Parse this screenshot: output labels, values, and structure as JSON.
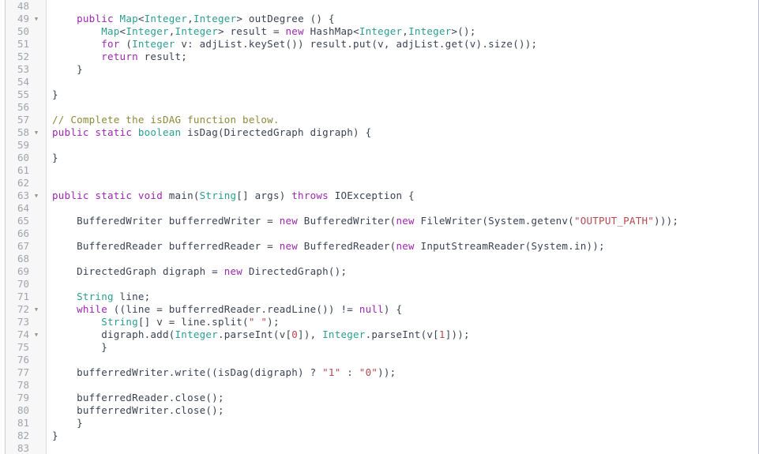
{
  "editor": {
    "language": "java",
    "first_line": 48,
    "last_line": 83,
    "line_height_px": 16,
    "colors": {
      "background": "#ffffff",
      "gutter_background": "#f7f7f7",
      "gutter_rule": "#dcdcdc",
      "left_rule": "#cfcfcf",
      "right_border": "#b9bcd0",
      "line_number": "#a0a4ab",
      "fold_arrow": "#9b8e82",
      "keyword": "#9c27b0",
      "type": "#2a9d8f",
      "string": "#b5484d",
      "comment": "#8a8a3a",
      "plain": "#3b4252"
    },
    "fold_arrow_glyph": "▼",
    "fold_lines": [
      49,
      58,
      63,
      72,
      74
    ],
    "lines": [
      {
        "n": 48,
        "fold": false,
        "tokens": []
      },
      {
        "n": 49,
        "fold": true,
        "tokens": [
          {
            "t": "    ",
            "c": "pln"
          },
          {
            "t": "public",
            "c": "kw"
          },
          {
            "t": " ",
            "c": "pln"
          },
          {
            "t": "Map",
            "c": "type"
          },
          {
            "t": "<",
            "c": "pln"
          },
          {
            "t": "Integer",
            "c": "type"
          },
          {
            "t": ",",
            "c": "pln"
          },
          {
            "t": "Integer",
            "c": "type"
          },
          {
            "t": "> outDegree () {",
            "c": "pln"
          }
        ]
      },
      {
        "n": 50,
        "fold": false,
        "tokens": [
          {
            "t": "        ",
            "c": "pln"
          },
          {
            "t": "Map",
            "c": "type"
          },
          {
            "t": "<",
            "c": "pln"
          },
          {
            "t": "Integer",
            "c": "type"
          },
          {
            "t": ",",
            "c": "pln"
          },
          {
            "t": "Integer",
            "c": "type"
          },
          {
            "t": "> result = ",
            "c": "pln"
          },
          {
            "t": "new",
            "c": "kw"
          },
          {
            "t": " HashMap<",
            "c": "pln"
          },
          {
            "t": "Integer",
            "c": "type"
          },
          {
            "t": ",",
            "c": "pln"
          },
          {
            "t": "Integer",
            "c": "type"
          },
          {
            "t": ">();",
            "c": "pln"
          }
        ]
      },
      {
        "n": 51,
        "fold": false,
        "tokens": [
          {
            "t": "        ",
            "c": "pln"
          },
          {
            "t": "for",
            "c": "kw"
          },
          {
            "t": " (",
            "c": "pln"
          },
          {
            "t": "Integer",
            "c": "type"
          },
          {
            "t": " v: adjList.keySet()) result.put(v, adjList.get(v).size());",
            "c": "pln"
          }
        ]
      },
      {
        "n": 52,
        "fold": false,
        "tokens": [
          {
            "t": "        ",
            "c": "pln"
          },
          {
            "t": "return",
            "c": "kw"
          },
          {
            "t": " result;",
            "c": "pln"
          }
        ]
      },
      {
        "n": 53,
        "fold": false,
        "tokens": [
          {
            "t": "    }",
            "c": "pln"
          }
        ]
      },
      {
        "n": 54,
        "fold": false,
        "tokens": []
      },
      {
        "n": 55,
        "fold": false,
        "tokens": [
          {
            "t": "}",
            "c": "pln"
          }
        ]
      },
      {
        "n": 56,
        "fold": false,
        "tokens": []
      },
      {
        "n": 57,
        "fold": false,
        "tokens": [
          {
            "t": "// Complete the isDAG function below.",
            "c": "cmt"
          }
        ]
      },
      {
        "n": 58,
        "fold": true,
        "tokens": [
          {
            "t": "public",
            "c": "kw"
          },
          {
            "t": " ",
            "c": "pln"
          },
          {
            "t": "static",
            "c": "kw"
          },
          {
            "t": " ",
            "c": "pln"
          },
          {
            "t": "boolean",
            "c": "type"
          },
          {
            "t": " isDag(DirectedGraph digraph) {",
            "c": "pln"
          }
        ]
      },
      {
        "n": 59,
        "fold": false,
        "tokens": []
      },
      {
        "n": 60,
        "fold": false,
        "tokens": [
          {
            "t": "}",
            "c": "pln"
          }
        ]
      },
      {
        "n": 61,
        "fold": false,
        "tokens": []
      },
      {
        "n": 62,
        "fold": false,
        "tokens": []
      },
      {
        "n": 63,
        "fold": true,
        "tokens": [
          {
            "t": "public",
            "c": "kw"
          },
          {
            "t": " ",
            "c": "pln"
          },
          {
            "t": "static",
            "c": "kw"
          },
          {
            "t": " ",
            "c": "pln"
          },
          {
            "t": "void",
            "c": "kw"
          },
          {
            "t": " main(",
            "c": "pln"
          },
          {
            "t": "String",
            "c": "type"
          },
          {
            "t": "[] args) ",
            "c": "pln"
          },
          {
            "t": "throws",
            "c": "kw"
          },
          {
            "t": " IOException {",
            "c": "pln"
          }
        ]
      },
      {
        "n": 64,
        "fold": false,
        "tokens": []
      },
      {
        "n": 65,
        "fold": false,
        "tokens": [
          {
            "t": "    BufferedWriter bufferredWriter = ",
            "c": "pln"
          },
          {
            "t": "new",
            "c": "kw"
          },
          {
            "t": " BufferedWriter(",
            "c": "pln"
          },
          {
            "t": "new",
            "c": "kw"
          },
          {
            "t": " FileWriter(System.getenv(",
            "c": "pln"
          },
          {
            "t": "\"OUTPUT_PATH\"",
            "c": "str"
          },
          {
            "t": ")));",
            "c": "pln"
          }
        ]
      },
      {
        "n": 66,
        "fold": false,
        "tokens": []
      },
      {
        "n": 67,
        "fold": false,
        "tokens": [
          {
            "t": "    BufferedReader bufferredReader = ",
            "c": "pln"
          },
          {
            "t": "new",
            "c": "kw"
          },
          {
            "t": " BufferedReader(",
            "c": "pln"
          },
          {
            "t": "new",
            "c": "kw"
          },
          {
            "t": " InputStreamReader(System.in));",
            "c": "pln"
          }
        ]
      },
      {
        "n": 68,
        "fold": false,
        "tokens": []
      },
      {
        "n": 69,
        "fold": false,
        "tokens": [
          {
            "t": "    DirectedGraph digraph = ",
            "c": "pln"
          },
          {
            "t": "new",
            "c": "kw"
          },
          {
            "t": " DirectedGraph();",
            "c": "pln"
          }
        ]
      },
      {
        "n": 70,
        "fold": false,
        "tokens": []
      },
      {
        "n": 71,
        "fold": false,
        "tokens": [
          {
            "t": "    ",
            "c": "pln"
          },
          {
            "t": "String",
            "c": "type"
          },
          {
            "t": " line;",
            "c": "pln"
          }
        ]
      },
      {
        "n": 72,
        "fold": true,
        "tokens": [
          {
            "t": "    ",
            "c": "pln"
          },
          {
            "t": "while",
            "c": "kw"
          },
          {
            "t": " ((line = bufferredReader.readLine()) != ",
            "c": "pln"
          },
          {
            "t": "null",
            "c": "kw"
          },
          {
            "t": ") {",
            "c": "pln"
          }
        ]
      },
      {
        "n": 73,
        "fold": false,
        "tokens": [
          {
            "t": "        ",
            "c": "pln"
          },
          {
            "t": "String",
            "c": "type"
          },
          {
            "t": "[] v = line.split(",
            "c": "pln"
          },
          {
            "t": "\" \"",
            "c": "str"
          },
          {
            "t": ");",
            "c": "pln"
          }
        ]
      },
      {
        "n": 74,
        "fold": true,
        "tokens": [
          {
            "t": "        digraph.add(",
            "c": "pln"
          },
          {
            "t": "Integer",
            "c": "type"
          },
          {
            "t": ".parseInt(v[",
            "c": "pln"
          },
          {
            "t": "0",
            "c": "num"
          },
          {
            "t": "]), ",
            "c": "pln"
          },
          {
            "t": "Integer",
            "c": "type"
          },
          {
            "t": ".parseInt(v[",
            "c": "pln"
          },
          {
            "t": "1",
            "c": "num"
          },
          {
            "t": "]));",
            "c": "pln"
          }
        ]
      },
      {
        "n": 75,
        "fold": false,
        "tokens": [
          {
            "t": "        }",
            "c": "pln"
          }
        ]
      },
      {
        "n": 76,
        "fold": false,
        "tokens": []
      },
      {
        "n": 77,
        "fold": false,
        "tokens": [
          {
            "t": "    bufferredWriter.write((isDag(digraph) ? ",
            "c": "pln"
          },
          {
            "t": "\"1\"",
            "c": "str"
          },
          {
            "t": " : ",
            "c": "pln"
          },
          {
            "t": "\"0\"",
            "c": "str"
          },
          {
            "t": "));",
            "c": "pln"
          }
        ]
      },
      {
        "n": 78,
        "fold": false,
        "tokens": []
      },
      {
        "n": 79,
        "fold": false,
        "tokens": [
          {
            "t": "    bufferredReader.close();",
            "c": "pln"
          }
        ]
      },
      {
        "n": 80,
        "fold": false,
        "tokens": [
          {
            "t": "    bufferredWriter.close();",
            "c": "pln"
          }
        ]
      },
      {
        "n": 81,
        "fold": false,
        "tokens": [
          {
            "t": "    }",
            "c": "pln"
          }
        ]
      },
      {
        "n": 82,
        "fold": false,
        "tokens": [
          {
            "t": "}",
            "c": "pln"
          }
        ]
      },
      {
        "n": 83,
        "fold": false,
        "tokens": []
      }
    ]
  }
}
